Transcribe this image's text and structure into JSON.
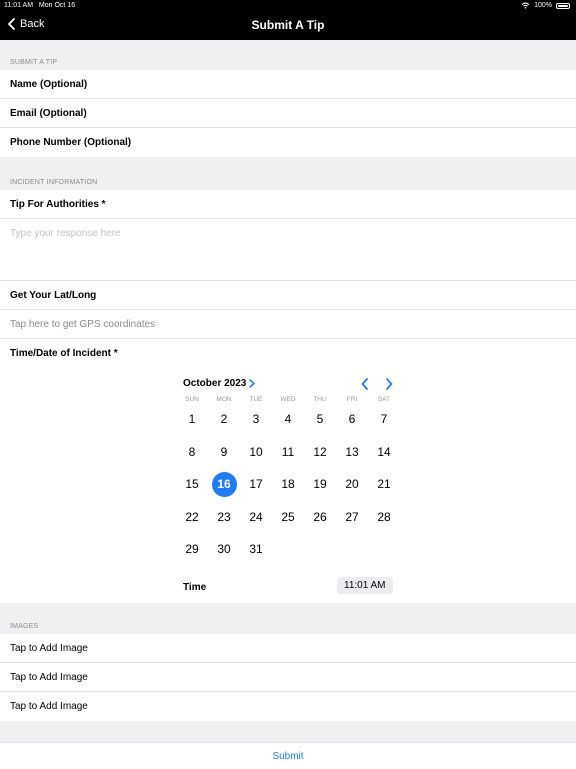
{
  "status_bar": {
    "time": "11:01 AM",
    "date": "Mon Oct 16",
    "battery": "100%"
  },
  "nav": {
    "back_label": "Back",
    "title": "Submit A Tip"
  },
  "sections": {
    "submit_tip": {
      "header": "SUBMIT A TIP",
      "rows": [
        "Name (Optional)",
        "Email (Optional)",
        "Phone Number (Optional)"
      ]
    },
    "incident": {
      "header": "INCIDENT INFORMATION",
      "tip_label": "Tip For Authorities *",
      "tip_placeholder": "Type your response here",
      "latlong_label": "Get Your Lat/Long",
      "gps_placeholder": "Tap here to get GPS coordinates",
      "datetime_label": "Time/Date of Incident *"
    },
    "images": {
      "header": "IMAGES",
      "rows": [
        "Tap to Add Image",
        "Tap to Add Image",
        "Tap to Add Image"
      ]
    }
  },
  "calendar": {
    "month_label": "October 2023",
    "weekdays": [
      "SUN",
      "MON",
      "TUE",
      "WED",
      "THU",
      "FRI",
      "SAT"
    ],
    "days": [
      "1",
      "2",
      "3",
      "4",
      "5",
      "6",
      "7",
      "8",
      "9",
      "10",
      "11",
      "12",
      "13",
      "14",
      "15",
      "16",
      "17",
      "18",
      "19",
      "20",
      "21",
      "22",
      "23",
      "24",
      "25",
      "26",
      "27",
      "28",
      "29",
      "30",
      "31"
    ],
    "selected_day": "16",
    "time_label": "Time",
    "time_value": "11:01 AM",
    "accent_color": "#1f7cf3"
  },
  "submit_label": "Submit"
}
